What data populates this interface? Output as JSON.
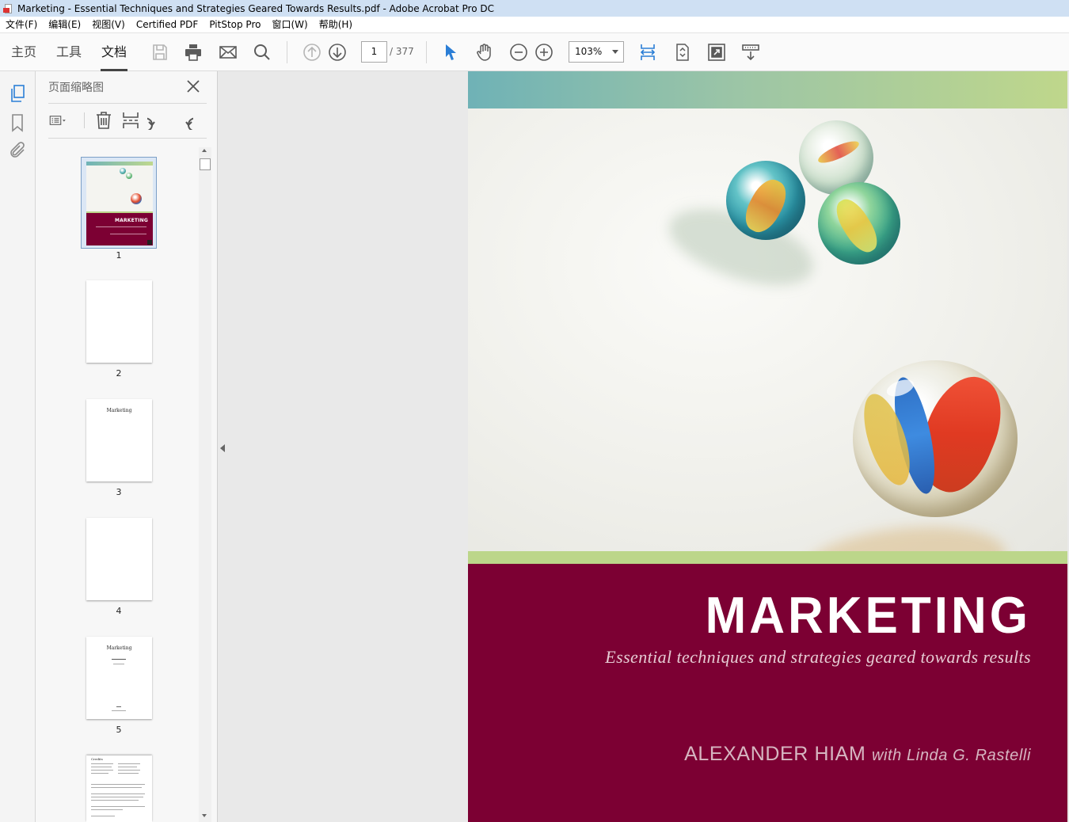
{
  "window": {
    "title": "Marketing - Essential Techniques and Strategies Geared Towards Results.pdf - Adobe Acrobat Pro DC"
  },
  "menu": [
    "文件(F)",
    "编辑(E)",
    "视图(V)",
    "Certified PDF",
    "PitStop Pro",
    "窗口(W)",
    "帮助(H)"
  ],
  "tabs": {
    "home": "主页",
    "tools": "工具",
    "document": "文档"
  },
  "toolbar": {
    "page_current": "1",
    "page_total": "/ 377",
    "zoom": "103%"
  },
  "icons": {
    "save": "save-icon",
    "print": "print-icon",
    "email": "email-icon",
    "search": "search-icon",
    "prev_page": "arrow-up-circle-icon",
    "next_page": "arrow-down-circle-icon",
    "select": "pointer-icon",
    "hand": "hand-icon",
    "zoom_out": "minus-circle-icon",
    "zoom_in": "plus-circle-icon"
  },
  "panel": {
    "title": "页面缩略图",
    "thumbnails": [
      {
        "num": "1",
        "text": "MARKETING"
      },
      {
        "num": "2",
        "text": ""
      },
      {
        "num": "3",
        "text": "Marketing"
      },
      {
        "num": "4",
        "text": ""
      },
      {
        "num": "5",
        "text": "Marketing"
      },
      {
        "num": "",
        "text": "Credits"
      }
    ]
  },
  "cover": {
    "title": "MARKETING",
    "subtitle": "Essential techniques and strategies geared towards results",
    "author": "ALEXANDER HIAM",
    "coauthor": "with Linda G. Rastelli",
    "colors": {
      "burgundy": "#7c0033",
      "green_band": "#bcd68a",
      "teal": "#6fb2b6"
    }
  }
}
